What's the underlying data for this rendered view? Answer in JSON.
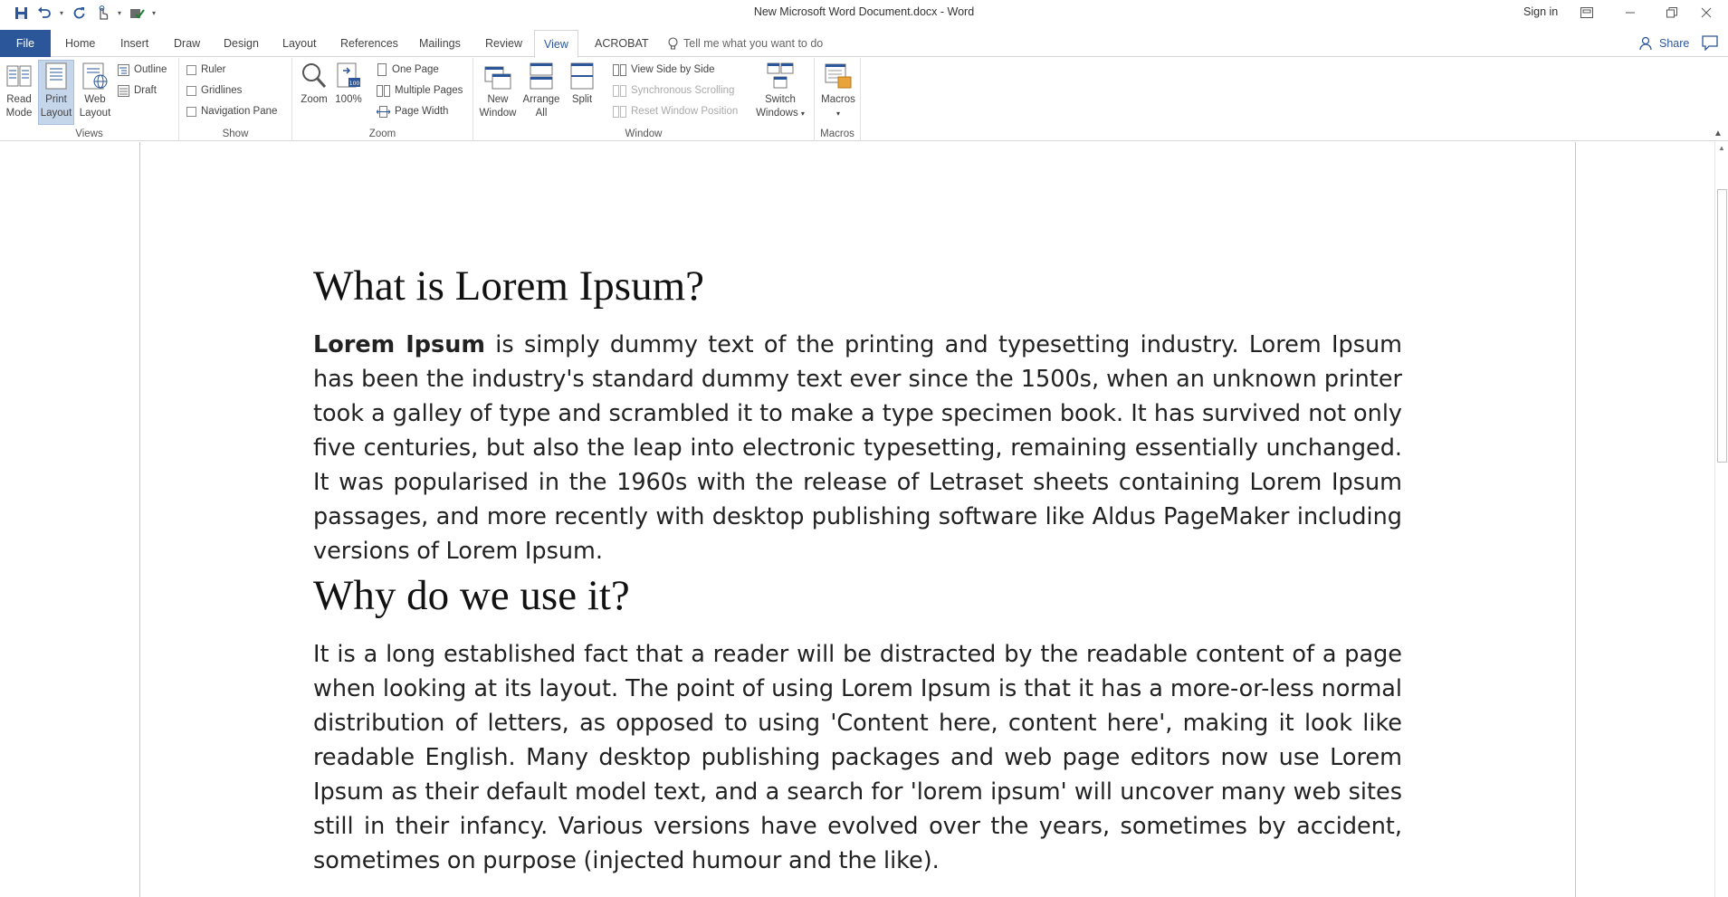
{
  "window": {
    "title": "New Microsoft Word Document.docx - Word",
    "sign_in": "Sign in"
  },
  "quick_access": {
    "icons": [
      "save-icon",
      "undo-icon",
      "redo-icon",
      "touch-mode-icon",
      "spelling-icon",
      "customize-icon"
    ]
  },
  "tabs": {
    "file": "File",
    "items": [
      "Home",
      "Insert",
      "Draw",
      "Design",
      "Layout",
      "References",
      "Mailings",
      "Review",
      "View",
      "ACROBAT"
    ],
    "active": "View",
    "tell_me": "Tell me what you want to do",
    "share": "Share"
  },
  "ribbon": {
    "views": {
      "label": "Views",
      "read_mode": [
        "Read",
        "Mode"
      ],
      "print_layout": [
        "Print",
        "Layout"
      ],
      "web_layout": [
        "Web",
        "Layout"
      ],
      "outline": "Outline",
      "draft": "Draft"
    },
    "show": {
      "label": "Show",
      "ruler": "Ruler",
      "gridlines": "Gridlines",
      "navigation_pane": "Navigation Pane"
    },
    "zoom": {
      "label": "Zoom",
      "zoom": "Zoom",
      "hundred": "100%",
      "one_page": "One Page",
      "multiple_pages": "Multiple Pages",
      "page_width": "Page Width"
    },
    "window": {
      "label": "Window",
      "new_window": [
        "New",
        "Window"
      ],
      "arrange_all": [
        "Arrange",
        "All"
      ],
      "split": "Split",
      "view_side_by_side": "View Side by Side",
      "synchronous_scrolling": "Synchronous Scrolling",
      "reset_window_position": "Reset Window Position",
      "switch_windows": [
        "Switch",
        "Windows"
      ]
    },
    "macros": {
      "label": "Macros",
      "macros": "Macros"
    }
  },
  "document": {
    "heading1": "What is Lorem Ipsum?",
    "para1_bold": "Lorem Ipsum",
    "para1_rest": " is simply dummy text of the printing and typesetting industry. Lorem Ipsum has been the industry's standard dummy text ever since the 1500s, when an unknown printer took a galley of type and scrambled it to make a type specimen book. It has survived not only five centuries, but also the leap into electronic typesetting, remaining essentially unchanged. It was popularised in the 1960s with the release of Letraset sheets containing Lorem Ipsum passages, and more recently with desktop publishing software like Aldus PageMaker including versions of Lorem Ipsum.",
    "heading2": "Why do we use it?",
    "para2": "It is a long established fact that a reader will be distracted by the readable content of a page when looking at its layout. The point of using Lorem Ipsum is that it has a more-or-less normal distribution of letters, as opposed to using 'Content here, content here', making it look like readable English. Many desktop publishing packages and web page editors now use Lorem Ipsum as their default model text, and a search for 'lorem ipsum' will uncover many web sites still in their infancy. Various versions have evolved over the years, sometimes by accident, sometimes on purpose (injected humour and the like)."
  },
  "colors": {
    "accent": "#2b579a",
    "selected": "#c5d5ea"
  }
}
